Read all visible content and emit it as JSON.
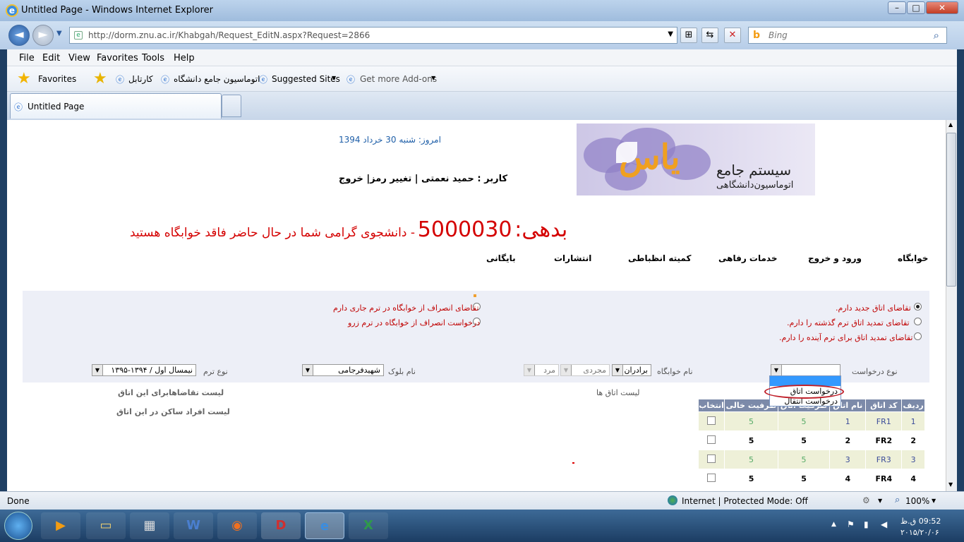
{
  "window": {
    "title": "Untitled Page - Windows Internet Explorer"
  },
  "browser": {
    "url": "http://dorm.znu.ac.ir/Khabgah/Request_EditN.aspx?Request=2866",
    "search_placeholder": "Bing",
    "menu": [
      "File",
      "Edit",
      "View",
      "Favorites",
      "Tools",
      "Help"
    ],
    "favorites_label": "Favorites",
    "fav_links": [
      "کارتابل",
      "اتوماسیون جامع دانشگاه",
      "Suggested Sites",
      "Get more Add-ons"
    ],
    "tab_title": "Untitled Page",
    "status_left": "Done",
    "status_zone": "Internet | Protected Mode: Off",
    "zoom": "100%"
  },
  "header": {
    "logo_title": "سیستم جامع",
    "logo_subtitle": "اتوماسیون‌دانشگاهی",
    "logo_mark": "یاس",
    "today": "امروز: شنبه 30 خرداد 1394",
    "user_line": "کاربر : حمید نعمتی | تغییر رمز| خروج",
    "debt_label": "بدهی:",
    "debt_value": "5000030",
    "debt_message": "- دانشجوی گرامی شما در حال حاضر فاقد خوابگاه هستید"
  },
  "nav": [
    "خوابگاه",
    "ورود و خروج",
    "خدمات رفاهی",
    "کمیته انظباطی",
    "انتشارات",
    "بایگانی"
  ],
  "form": {
    "options_right": [
      "تقاضای اتاق جدید دارم.",
      "تقاضای تمدید اتاق ترم گذشته را دارم.",
      "تقاضای تمدید اتاق برای ترم آینده را دارم."
    ],
    "options_left": [
      "تقاضای انصراف از خوابگاه در ترم جاری دارم",
      "درخواست انصراف از خوابگاه در ترم زرو"
    ],
    "request_type_label": "نوع درخواست",
    "dorm_name_label": "نام خوابگاه",
    "dorm_name_value": "برادران",
    "marital_value": "مجردی",
    "gender_value": "مرد",
    "block_label": "نام بلوک",
    "block_value": "شهیدفرجامی",
    "term_label": "نوع ترم",
    "term_value": "نیمسال اول / ۱۳۹۴-۱۳۹۵",
    "dropdown_options": [
      "درخواست اتاق",
      "درخواست انتقال"
    ]
  },
  "sections": {
    "rooms_list": "لیست اتاق ها",
    "requests_list": "لیست تقاضاهابرای این اتاق",
    "residents_list": "لیست افراد ساکن در این اتاق"
  },
  "table": {
    "headers": [
      "ردیف",
      "کد اتاق",
      "نام اتاق",
      "ظرفیت اتاق",
      "ظرفیت خالی",
      "انتخاب"
    ],
    "rows": [
      [
        "1",
        "FR1",
        "1",
        "5",
        "5"
      ],
      [
        "2",
        "FR2",
        "2",
        "5",
        "5"
      ],
      [
        "3",
        "FR3",
        "3",
        "5",
        "5"
      ],
      [
        "4",
        "FR4",
        "4",
        "5",
        "5"
      ]
    ]
  },
  "taskbar": {
    "time": "09:52 ق.ظ",
    "date": "۲۰۱۵/۲۰/۰۶"
  }
}
